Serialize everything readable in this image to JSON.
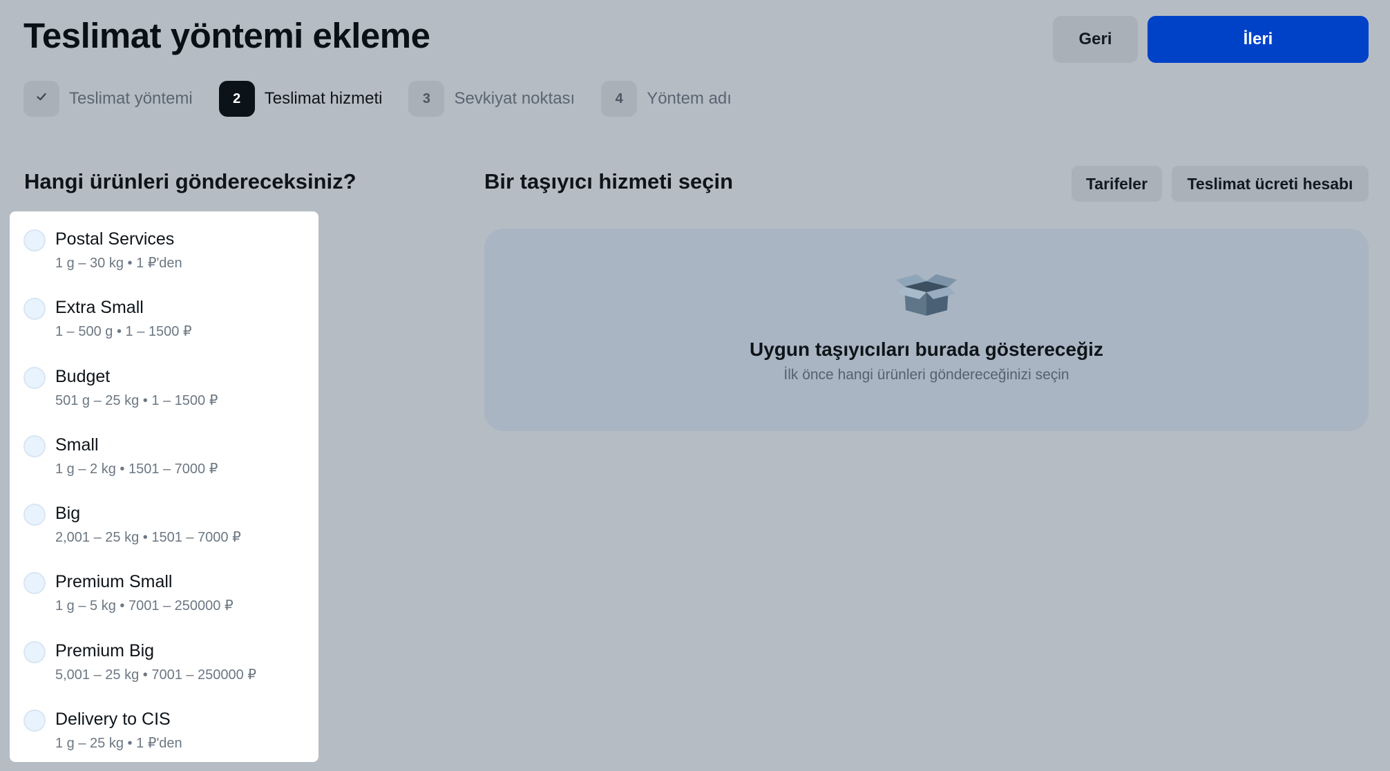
{
  "header": {
    "title": "Teslimat yöntemi ekleme",
    "back_label": "Geri",
    "next_label": "İleri"
  },
  "stepper": {
    "steps": [
      {
        "badge": "",
        "label": "Teslimat yöntemi",
        "state": "done",
        "icon": "check-icon"
      },
      {
        "badge": "2",
        "label": "Teslimat hizmeti",
        "state": "active"
      },
      {
        "badge": "3",
        "label": "Sevkiyat noktası",
        "state": "pending"
      },
      {
        "badge": "4",
        "label": "Yöntem adı",
        "state": "pending"
      }
    ]
  },
  "products": {
    "title": "Hangi ürünleri göndereceksiniz?",
    "items": [
      {
        "name": "Postal Services",
        "meta": "1 g – 30 kg • 1 ₽'den"
      },
      {
        "name": "Extra Small",
        "meta": "1 – 500 g • 1 – 1500 ₽"
      },
      {
        "name": "Budget",
        "meta": "501 g – 25 kg • 1 – 1500 ₽"
      },
      {
        "name": "Small",
        "meta": "1 g – 2 kg • 1501 – 7000 ₽"
      },
      {
        "name": "Big",
        "meta": "2,001 – 25 kg • 1501 – 7000 ₽"
      },
      {
        "name": "Premium Small",
        "meta": "1 g – 5 kg • 7001 – 250000 ₽"
      },
      {
        "name": "Premium Big",
        "meta": "5,001 – 25 kg • 7001 – 250000 ₽"
      },
      {
        "name": "Delivery to CIS",
        "meta": "1 g – 25 kg • 1 ₽'den"
      }
    ]
  },
  "carrier": {
    "title": "Bir taşıyıcı hizmeti seçin",
    "tariffs_label": "Tarifeler",
    "calc_label": "Teslimat ücreti hesabı",
    "empty_icon": "box-icon",
    "empty_title": "Uygun taşıyıcıları burada göstereceğiz",
    "empty_subtitle": "İlk önce hangi ürünleri göndereceğinizi seçin"
  },
  "colors": {
    "background": "#b5bcc4",
    "accent": "#0042c7",
    "active_step": "#0b1218",
    "card": "#ffffff",
    "empty_panel": "#a9b5c2"
  }
}
